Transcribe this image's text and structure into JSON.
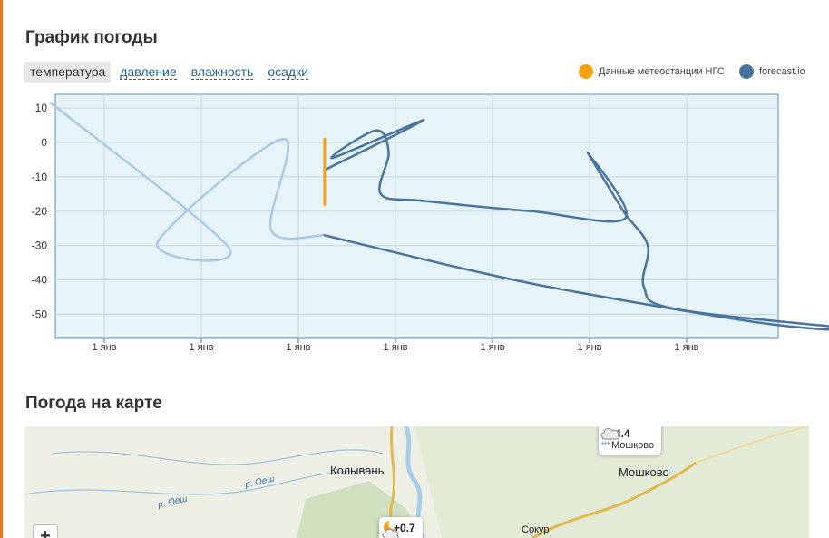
{
  "weather_chart": {
    "title": "График погоды",
    "tabs": [
      {
        "label": "температура",
        "active": true
      },
      {
        "label": "давление",
        "active": false
      },
      {
        "label": "влажность",
        "active": false
      },
      {
        "label": "осадки",
        "active": false
      }
    ],
    "legend": [
      {
        "name": "Данные метеостанции НГС",
        "color": "#f5a00f"
      },
      {
        "name": "forecast.io",
        "color": "#4a74a0"
      }
    ]
  },
  "chart_data": {
    "type": "line",
    "title": "",
    "xlabel": "",
    "ylabel": "",
    "ylim": [
      -57,
      14
    ],
    "yticks": [
      10,
      0,
      -10,
      -20,
      -30,
      -40,
      -50
    ],
    "xtick_labels": [
      "1 янв",
      "1 янв",
      "1 янв",
      "1 янв",
      "1 янв",
      "1 янв",
      "1 янв"
    ],
    "grid": true,
    "legend_position": "top-right",
    "series": [
      {
        "name": "Данные метеостанции НГС",
        "color": "#f5a00f",
        "points": [
          [
            2.27,
            1
          ],
          [
            2.27,
            -18
          ]
        ]
      },
      {
        "name": "forecast.io",
        "color": "#4a74a0",
        "segments": [
          [
            [
              -0.55,
              11.5
            ],
            [
              1.28,
              -30.5
            ],
            [
              0.55,
              -29
            ],
            [
              1.84,
              1
            ],
            [
              1.72,
              -25.5
            ],
            [
              2.27,
              -27
            ]
          ],
          [
            [
              2.27,
              -27
            ],
            [
              3.9,
              -38
            ],
            [
              5.06,
              -44.5
            ],
            [
              6.9,
              -53
            ],
            [
              7.95,
              -55
            ]
          ],
          [
            [
              2.27,
              -8
            ],
            [
              3.29,
              6.5
            ],
            [
              2.35,
              -4.5
            ],
            [
              2.8,
              3.5
            ],
            [
              2.93,
              -3
            ],
            [
              2.85,
              -15
            ],
            [
              3.3,
              -17
            ],
            [
              4.4,
              -20
            ],
            [
              5.37,
              -22
            ],
            [
              4.98,
              -3
            ],
            [
              5.35,
              -20
            ],
            [
              5.6,
              -30
            ],
            [
              5.56,
              -42
            ],
            [
              5.9,
              -48.5
            ],
            [
              7.85,
              -54.5
            ],
            [
              7.95,
              -55
            ]
          ]
        ]
      }
    ],
    "series_opacity_note": ""
  },
  "weather_map": {
    "title": "Погода на карте",
    "places": [
      {
        "label": "Колывань"
      },
      {
        "label": "Мошково"
      },
      {
        "label": "Сокур"
      }
    ],
    "rivers": [
      {
        "label": "р. Оеш"
      },
      {
        "label": "р. Оеш"
      }
    ],
    "popups": [
      {
        "temp": "-4.4",
        "place": "Мошково",
        "icon": "cloud-snow-icon"
      },
      {
        "temp": "+0.7",
        "place": "",
        "icon": "cloud-moon-icon"
      }
    ],
    "zoom_in_label": "+"
  }
}
